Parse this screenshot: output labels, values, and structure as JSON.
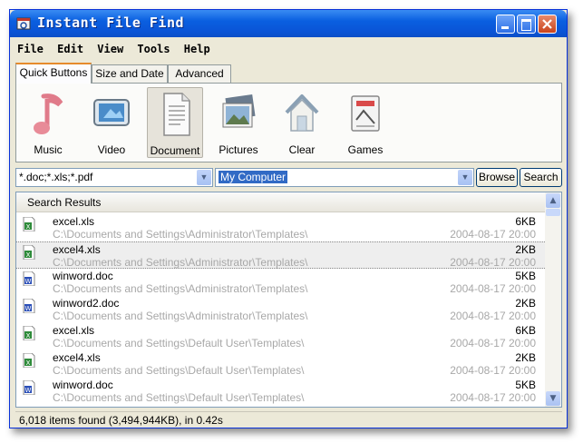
{
  "window": {
    "title": "Instant File Find"
  },
  "menu": [
    "File",
    "Edit",
    "View",
    "Tools",
    "Help"
  ],
  "tabs": [
    {
      "label": "Quick Buttons",
      "active": true
    },
    {
      "label": "Size and Date",
      "active": false
    },
    {
      "label": "Advanced",
      "active": false
    }
  ],
  "quick_buttons": [
    {
      "label": "Music",
      "icon": "music-note-icon"
    },
    {
      "label": "Video",
      "icon": "video-icon"
    },
    {
      "label": "Document",
      "icon": "document-icon",
      "selected": true
    },
    {
      "label": "Pictures",
      "icon": "pictures-icon"
    },
    {
      "label": "Clear",
      "icon": "house-icon"
    },
    {
      "label": "Games",
      "icon": "games-icon"
    }
  ],
  "search": {
    "pattern": "*.doc;*.xls;*.pdf",
    "location": "My Computer",
    "browse_label": "Browse",
    "search_label": "Search"
  },
  "results": {
    "header": "Search Results",
    "items": [
      {
        "name": "excel.xls",
        "size": "6KB",
        "path": "C:\\Documents and Settings\\Administrator\\Templates\\",
        "date": "2004-08-17 20:00",
        "type": "xls"
      },
      {
        "name": "excel4.xls",
        "size": "2KB",
        "path": "C:\\Documents and Settings\\Administrator\\Templates\\",
        "date": "2004-08-17 20:00",
        "type": "xls",
        "highlighted": true
      },
      {
        "name": "winword.doc",
        "size": "5KB",
        "path": "C:\\Documents and Settings\\Administrator\\Templates\\",
        "date": "2004-08-17 20:00",
        "type": "doc"
      },
      {
        "name": "winword2.doc",
        "size": "2KB",
        "path": "C:\\Documents and Settings\\Administrator\\Templates\\",
        "date": "2004-08-17 20:00",
        "type": "doc"
      },
      {
        "name": "excel.xls",
        "size": "6KB",
        "path": "C:\\Documents and Settings\\Default User\\Templates\\",
        "date": "2004-08-17 20:00",
        "type": "xls"
      },
      {
        "name": "excel4.xls",
        "size": "2KB",
        "path": "C:\\Documents and Settings\\Default User\\Templates\\",
        "date": "2004-08-17 20:00",
        "type": "xls"
      },
      {
        "name": "winword.doc",
        "size": "5KB",
        "path": "C:\\Documents and Settings\\Default User\\Templates\\",
        "date": "2004-08-17 20:00",
        "type": "doc"
      }
    ]
  },
  "status": "6,018 items found (3,494,944KB), in 0.42s",
  "colors": {
    "titlebar": "#0a5fe0",
    "selection": "#316ac5",
    "xls_icon": "#2e8b3a",
    "doc_icon": "#2b4fb8"
  }
}
